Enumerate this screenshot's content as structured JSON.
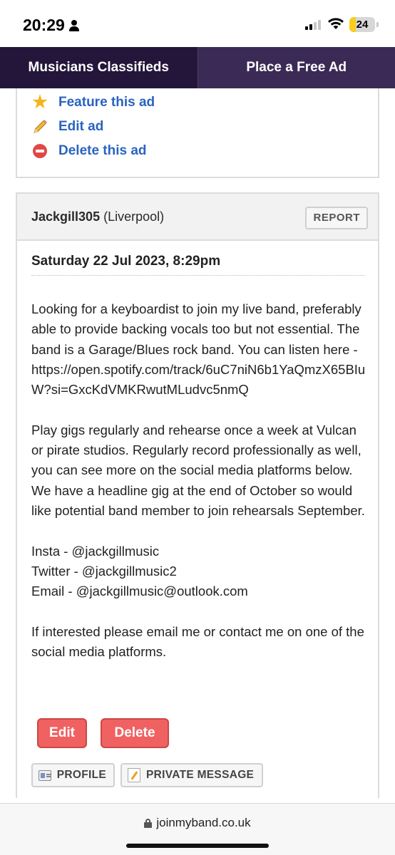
{
  "status_bar": {
    "time": "20:29",
    "battery": "24",
    "battery_color": "#f7ce1b"
  },
  "nav": {
    "left_tab": "Musicians Classifieds",
    "right_tab": "Place a Free Ad",
    "left_color": "#24163a",
    "right_color": "#3b2a55"
  },
  "actions": {
    "feature": "Feature this ad",
    "edit": "Edit ad",
    "delete": "Delete this ad",
    "icons": [
      "star-icon",
      "pencil-icon",
      "no-entry-icon"
    ]
  },
  "ad": {
    "username": "Jackgill305",
    "location": " (Liverpool)",
    "report": "REPORT",
    "date": "Saturday 22 Jul 2023, 8:29pm",
    "body": "Looking for a keyboardist to join my live band, preferably able to provide backing vocals too but not essential. The band is a Garage/Blues rock band. You can listen here - https://open.spotify.com/track/6uC7niN6b1YaQmzX65BIuW?si=GxcKdVMKRwutMLudvc5nmQ\n\nPlay gigs regularly and rehearse once a week at Vulcan or pirate studios. Regularly record professionally as well, you can see more on the social media platforms below. We have a headline gig at the end of October so would like potential band member to join rehearsals September.\n\nInsta - @jackgillmusic\nTwitter - @jackgillmusic2\nEmail - @jackgillmusic@outlook.com\n\nIf interested please email me or contact me on one of the social media platforms.",
    "edit_button": "Edit",
    "delete_button": "Delete",
    "profile_button": "PROFILE",
    "message_button": "PRIVATE MESSAGE",
    "button_color": "#f06262"
  },
  "browser": {
    "url": "joinmyband.co.uk"
  }
}
